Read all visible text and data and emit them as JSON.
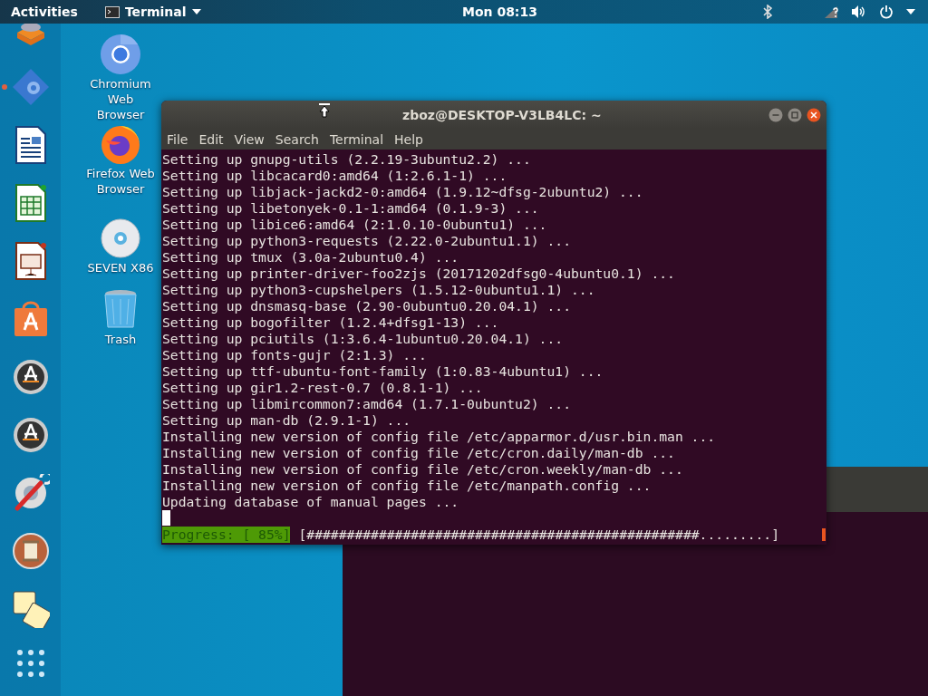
{
  "top_bar": {
    "activities": "Activities",
    "app_menu": "Terminal",
    "clock": "Mon 08:13"
  },
  "dock": [
    {
      "kind": "layers",
      "running": false
    },
    {
      "kind": "diamond",
      "running": true
    },
    {
      "kind": "writer",
      "running": false
    },
    {
      "kind": "calc",
      "running": false
    },
    {
      "kind": "impress",
      "running": false
    },
    {
      "kind": "store",
      "running": false
    },
    {
      "kind": "updater",
      "running": false
    },
    {
      "kind": "updater",
      "running": false
    },
    {
      "kind": "tools",
      "running": false
    },
    {
      "kind": "scroll",
      "running": false
    },
    {
      "kind": "tiles",
      "running": false
    }
  ],
  "desktop_icons": [
    {
      "kind": "chromium",
      "label": "Chromium Web Browser"
    },
    {
      "kind": "firefox",
      "label": "Firefox Web Browser"
    },
    {
      "kind": "disc",
      "label": "SEVEN X86"
    },
    {
      "kind": "trash",
      "label": "Trash"
    }
  ],
  "terminal": {
    "title": "zboz@DESKTOP-V3LB4LC: ~",
    "menu": [
      "File",
      "Edit",
      "View",
      "Search",
      "Terminal",
      "Help"
    ],
    "lines": [
      "Setting up gnupg-utils (2.2.19-3ubuntu2.2) ...",
      "Setting up libcacard0:amd64 (1:2.6.1-1) ...",
      "Setting up libjack-jackd2-0:amd64 (1.9.12~dfsg-2ubuntu2) ...",
      "Setting up libetonyek-0.1-1:amd64 (0.1.9-3) ...",
      "Setting up libice6:amd64 (2:1.0.10-0ubuntu1) ...",
      "Setting up python3-requests (2.22.0-2ubuntu1.1) ...",
      "Setting up tmux (3.0a-2ubuntu0.4) ...",
      "Setting up printer-driver-foo2zjs (20171202dfsg0-4ubuntu0.1) ...",
      "Setting up python3-cupshelpers (1.5.12-0ubuntu1.1) ...",
      "Setting up dnsmasq-base (2.90-0ubuntu0.20.04.1) ...",
      "Setting up bogofilter (1.2.4+dfsg1-13) ...",
      "Setting up pciutils (1:3.6.4-1ubuntu0.20.04.1) ...",
      "Setting up fonts-gujr (2:1.3) ...",
      "Setting up ttf-ubuntu-font-family (1:0.83-4ubuntu1) ...",
      "Setting up gir1.2-rest-0.7 (0.8.1-1) ...",
      "Setting up libmircommon7:amd64 (1.7.1-0ubuntu2) ...",
      "Setting up man-db (2.9.1-1) ...",
      "Installing new version of config file /etc/apparmor.d/usr.bin.man ...",
      "Installing new version of config file /etc/cron.daily/man-db ...",
      "Installing new version of config file /etc/cron.weekly/man-db ...",
      "Installing new version of config file /etc/manpath.config ...",
      "Updating database of manual pages ..."
    ],
    "progress_label": "Progress: [ 85%]",
    "progress_bar": "[#################################################.........]"
  }
}
